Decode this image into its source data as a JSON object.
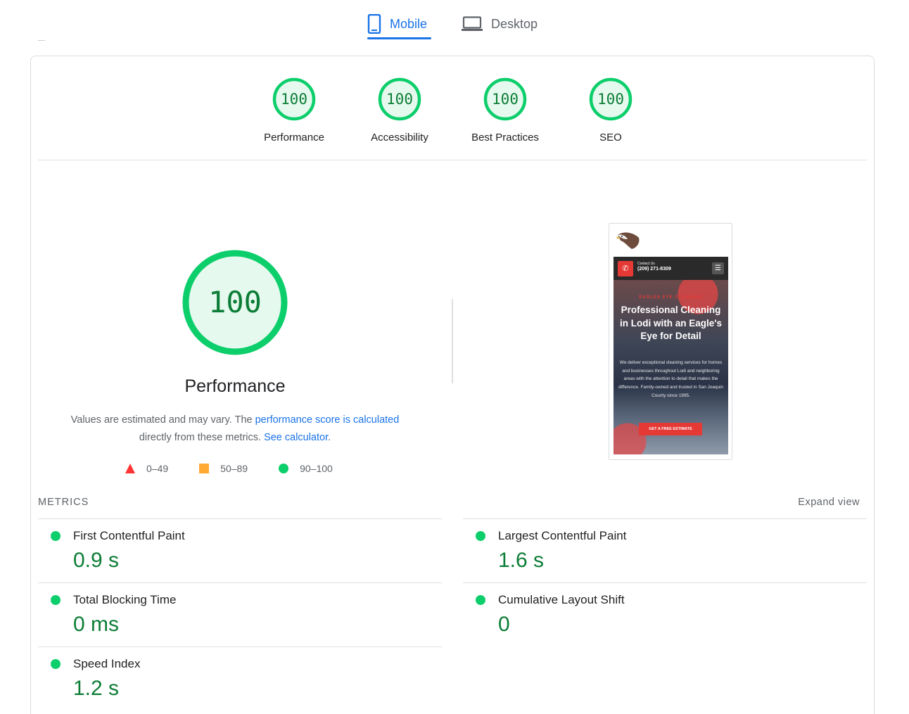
{
  "tabs": [
    {
      "label": "Mobile",
      "icon": "phone-icon",
      "selected": true
    },
    {
      "label": "Desktop",
      "icon": "laptop-icon",
      "selected": false
    }
  ],
  "colors": {
    "accent": "#1a73e8",
    "pass": "#0cce6b",
    "pass_text": "#0c7d36",
    "average": "#ffaa33",
    "fail": "#ff3333"
  },
  "categories": [
    {
      "label": "Performance",
      "score": "100"
    },
    {
      "label": "Accessibility",
      "score": "100"
    },
    {
      "label": "Best Practices",
      "score": "100"
    },
    {
      "label": "SEO",
      "score": "100"
    }
  ],
  "performance": {
    "score": "100",
    "title": "Performance",
    "desc_prefix": "Values are estimated and may vary. The ",
    "desc_link": "performance score is calculated",
    "desc_middle": " directly from these metrics. ",
    "desc_link2": "See calculator",
    "desc_suffix": "."
  },
  "legend": [
    {
      "label": "0–49",
      "shape": "triangle"
    },
    {
      "label": "50–89",
      "shape": "square"
    },
    {
      "label": "90–100",
      "shape": "circle"
    }
  ],
  "screenshot": {
    "contact_label": "Contact Us",
    "phone": "(209) 271-8309",
    "kicker": "EAGLES EYE CLEANING",
    "headline": "Professional Cleaning in Lodi with an Eagle's Eye for Detail",
    "body": "We deliver exceptional cleaning services for homes and businesses throughout Lodi and neighboring areas with the attention to detail that makes the difference. Family-owned and trusted in San Joaquin County since 1995.",
    "cta": "GET A FREE ESTIMATE"
  },
  "metrics": {
    "heading": "METRICS",
    "expand_label": "Expand view",
    "items": [
      {
        "name": "First Contentful Paint",
        "value": "0.9 s"
      },
      {
        "name": "Largest Contentful Paint",
        "value": "1.6 s"
      },
      {
        "name": "Total Blocking Time",
        "value": "0 ms"
      },
      {
        "name": "Cumulative Layout Shift",
        "value": "0"
      },
      {
        "name": "Speed Index",
        "value": "1.2 s"
      }
    ]
  }
}
